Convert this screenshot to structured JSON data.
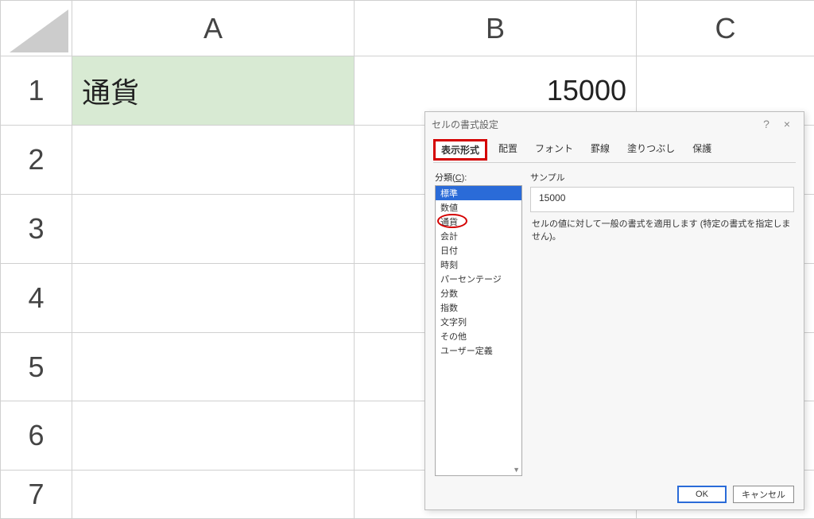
{
  "sheet": {
    "colHeaders": [
      "A",
      "B",
      "C"
    ],
    "rowHeaders": [
      "1",
      "2",
      "3",
      "4",
      "5",
      "6",
      "7"
    ],
    "cells": {
      "A1": "通貨",
      "B1": "15000"
    }
  },
  "dialog": {
    "title": "セルの書式設定",
    "help_glyph": "?",
    "close_glyph": "×",
    "tabs": {
      "format": "表示形式",
      "alignment": "配置",
      "font": "フォント",
      "border": "罫線",
      "fill": "塗りつぶし",
      "protect": "保護"
    },
    "category_label_prefix": "分類(",
    "category_label_key": "C",
    "category_label_suffix": "):",
    "categories": [
      "標準",
      "数値",
      "通貨",
      "会計",
      "日付",
      "時刻",
      "パーセンテージ",
      "分数",
      "指数",
      "文字列",
      "その他",
      "ユーザー定義"
    ],
    "selected_category_index": 0,
    "circled_category_index": 2,
    "sample_label": "サンプル",
    "sample_value": "15000",
    "description": "セルの値に対して一般の書式を適用します (特定の書式を指定しません)。",
    "buttons": {
      "ok": "OK",
      "cancel": "キャンセル"
    }
  }
}
